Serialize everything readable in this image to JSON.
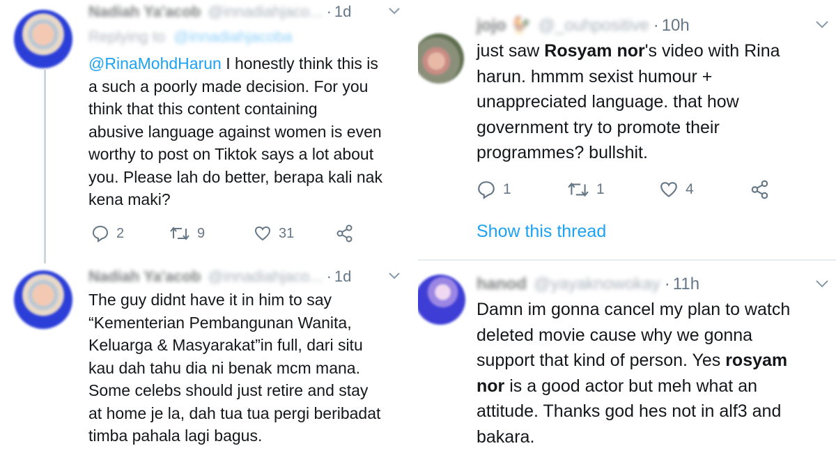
{
  "left": {
    "tweets": [
      {
        "name": "Nadiah Ya'acob",
        "handle": "@innadiahjaco...",
        "dot": "·",
        "time": "1d",
        "replying_label": "Replying to",
        "replying_to": "@innadiahjacoba",
        "mention": "@RinaMohdHarun",
        "text": " I honestly think this is\na such a poorly made decision. For you\nthink that this content containing\nabusive language against women is even\nworthy to post on Tiktok says a lot about\nyou. Please lah do better, berapa kali nak\nkena maki?",
        "replies": "2",
        "retweets": "9",
        "likes": "31"
      },
      {
        "name": "Nadiah Ya'acob",
        "handle": "@innadiahjaco...",
        "dot": "·",
        "time": "1d",
        "text": "The guy didnt have it in him to say\n“Kementerian Pembangunan Wanita,\nKeluarga & Masyarakat”in full, dari situ\nkau dah tahu dia ni benak mcm mana.\nSome celebs should just retire and stay\nat home je la, dah tua tua pergi beribadat\ntimba pahala lagi bagus."
      }
    ]
  },
  "right": {
    "tweets": [
      {
        "name": "jojo",
        "emoji": "🐓",
        "handle": "@_ouhpositive",
        "dot": "·",
        "time": "10h",
        "text_a": "just saw ",
        "bold_a": "Rosyam nor",
        "text_b": "'s video with Rina\nharun. hmmm sexist humour +\nunappreciated language. that how\ngovernment try to promote their\nprogrammes? bullshit.",
        "replies": "1",
        "retweets": "1",
        "likes": "4",
        "show_thread": "Show this thread"
      },
      {
        "name": "hanod",
        "handle": "@yayaknowokay",
        "dot": "·",
        "time": "11h",
        "text_a": "Damn im gonna cancel my plan to watch\ndeleted movie cause why we gonna\nsupport that kind of person. Yes ",
        "bold_a": "rosyam\nnor",
        "text_b": " is a good actor but meh what an\nattitude. Thanks god hes not in alf3 and\nbakara."
      }
    ]
  },
  "colors": {
    "text": "#14171a",
    "secondary": "#657786",
    "accent": "#1da1f2",
    "divider": "#e6ecf0"
  },
  "icons": [
    "reply-icon",
    "retweet-icon",
    "like-icon",
    "share-icon",
    "chevron-down-icon"
  ]
}
